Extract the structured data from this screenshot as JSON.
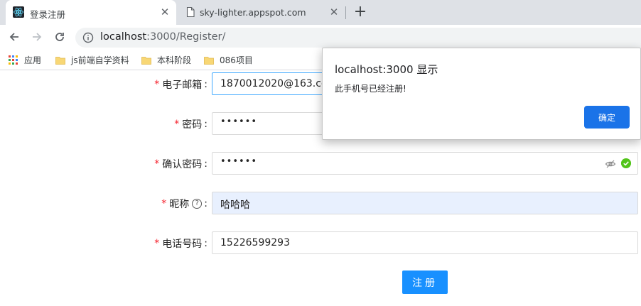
{
  "browser": {
    "tabs": [
      {
        "title": "登录注册",
        "active": true,
        "icon": "react-icon"
      },
      {
        "title": "sky-lighter.appspot.com",
        "active": false,
        "icon": "page-icon"
      }
    ],
    "address": {
      "host": "localhost",
      "path": ":3000/Register/"
    },
    "bookmarks": [
      {
        "label": "应用",
        "icon": "apps-icon"
      },
      {
        "label": "js前端自学资料",
        "icon": "folder-icon"
      },
      {
        "label": "本科阶段",
        "icon": "folder-icon"
      },
      {
        "label": "086项目",
        "icon": "folder-icon"
      }
    ]
  },
  "form": {
    "email_label": "电子邮箱",
    "email_value": "1870012020@163.com",
    "password_label": "密码",
    "password_value": "••••••",
    "confirm_label": "确认密码",
    "confirm_value": "••••••",
    "nickname_label": "昵称",
    "nickname_value": "哈哈哈",
    "phone_label": "电话号码",
    "phone_value": "15226599293",
    "required_mark": "*",
    "colon": ":",
    "help_glyph": "?",
    "submit_label": "注册"
  },
  "dialog": {
    "title": "localhost:3000 显示",
    "message": "此手机号已经注册!",
    "ok_label": "确定"
  },
  "colors": {
    "primary": "#1890ff",
    "dialog_button": "#1a73e8",
    "success": "#52c41a",
    "required": "#f5222d",
    "folder": "#f8d775"
  }
}
